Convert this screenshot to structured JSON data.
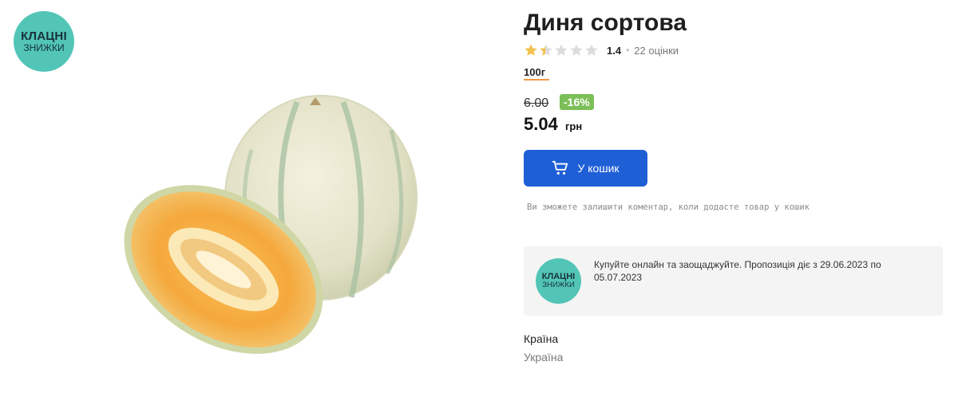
{
  "brand": {
    "line1": "КЛАЦНІ",
    "line2": "ЗНИЖКИ",
    "color": "#52c5b6"
  },
  "product": {
    "title": "Диня сортова",
    "image_icon": "melon-image",
    "rating": {
      "value": "1.4",
      "stars_filled": 1.4,
      "stars_total": 5,
      "separator": "•",
      "count": "22 оцінки"
    },
    "weight": "100г",
    "old_price": "6.00",
    "discount": "-16%",
    "price": "5.04",
    "currency": "грн"
  },
  "cart": {
    "label": "У кошик",
    "icon": "cart-icon",
    "color": "#1f5fd6"
  },
  "hint": "Ви зможете залишити коментар, коли додасте товар у кошик",
  "promo": {
    "logo_line1": "КЛАЦНІ",
    "logo_line2": "ЗНИЖКИ",
    "text": "Купуйте онлайн та заощаджуйте. Пропозиція діє з 29.06.2023 по 05.07.2023"
  },
  "attributes": {
    "country_label": "Країна",
    "country_value": "Україна"
  }
}
